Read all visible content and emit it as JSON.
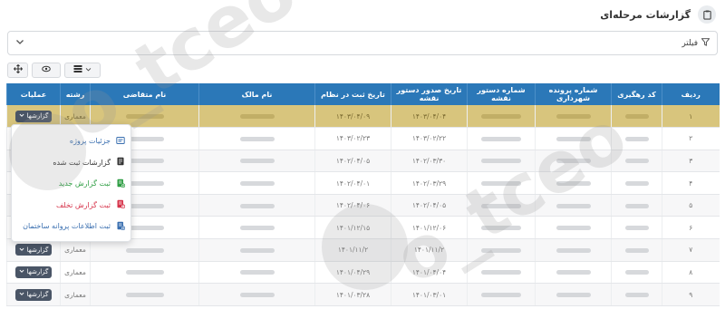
{
  "page": {
    "title": "گزارشات مرحله‌ای",
    "icon": "clipboard-icon"
  },
  "filter": {
    "label": "فیلتر"
  },
  "table": {
    "headers": [
      "ردیف",
      "کد رهگیری",
      "شماره پرونده شهرداری",
      "شماره دستور نقشه",
      "تاریخ صدور دستور نقشه",
      "تاریخ ثبت در نظام",
      "نام مالک",
      "نام متقاضی",
      "رشته",
      "عملیات"
    ],
    "rows": [
      {
        "index": "۱",
        "issue_date": "۱۴۰۳/۰۴/۰۴",
        "reg_date": "۱۴۰۳/۰۴/۰۹",
        "field": "معماری",
        "action": "گزارشها"
      },
      {
        "index": "۲",
        "issue_date": "۱۴۰۳/۰۲/۲۲",
        "reg_date": "۱۴۰۳/۰۲/۲۳",
        "field": "",
        "action": ""
      },
      {
        "index": "۳",
        "issue_date": "۱۴۰۲/۰۳/۳۰",
        "reg_date": "۱۴۰۲/۰۴/۰۵",
        "field": "",
        "action": ""
      },
      {
        "index": "۴",
        "issue_date": "۱۴۰۲/۰۳/۲۹",
        "reg_date": "۱۴۰۲/۰۴/۰۱",
        "field": "",
        "action": ""
      },
      {
        "index": "۵",
        "issue_date": "۱۴۰۲/۰۴/۰۵",
        "reg_date": "۱۴۰۲/۰۴/۰۶",
        "field": "",
        "action": ""
      },
      {
        "index": "۶",
        "issue_date": "۱۴۰۱/۱۲/۰۶",
        "reg_date": "۱۴۰۱/۱۲/۱۵",
        "field": "",
        "action": ""
      },
      {
        "index": "۷",
        "issue_date": "۱۴۰۱/۱۱/۲",
        "reg_date": "۱۴۰۱/۱۱/۲",
        "field": "معماری",
        "action": "گزارشها"
      },
      {
        "index": "۸",
        "issue_date": "۱۴۰۱/۰۴/۰۴",
        "reg_date": "۱۴۰۱/۰۴/۲۹",
        "field": "معماری",
        "action": "گزارشها"
      },
      {
        "index": "۹",
        "issue_date": "۱۴۰۱/۰۳/۰۱",
        "reg_date": "۱۴۰۱/۰۳/۲۸",
        "field": "معماری",
        "action": "گزارشها"
      }
    ]
  },
  "menu": {
    "items": [
      {
        "label": "جزئیات پروژه",
        "icon": "document-icon",
        "color": "#3a6fb0"
      },
      {
        "label": "گزارشات ثبت شده",
        "icon": "report-list-icon",
        "color": "#333333"
      },
      {
        "label": "ثبت گزارش جدید",
        "icon": "report-add-icon",
        "color": "#2f9e44"
      },
      {
        "label": "ثبت گزارش تخلف",
        "icon": "report-warning-icon",
        "color": "#d6334a"
      },
      {
        "label": "ثبت اطلاعات پروانه ساختمان",
        "icon": "building-permit-icon",
        "color": "#3a6fb0"
      }
    ]
  },
  "watermark": {
    "text": "o_tceo"
  },
  "colors": {
    "header": "#2b78b8",
    "highlight": "#d8c57d",
    "action_button": "#4a5566"
  }
}
